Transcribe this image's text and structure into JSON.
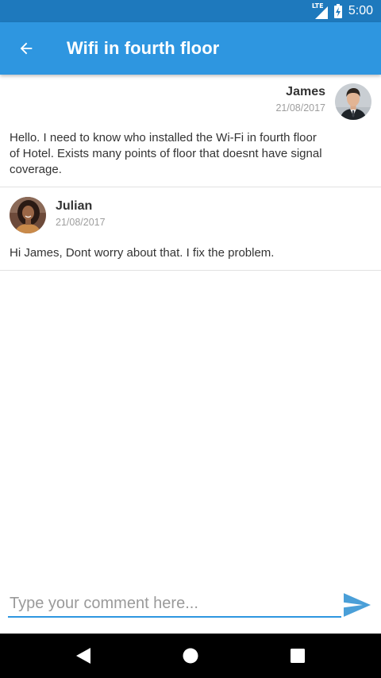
{
  "status_bar": {
    "network_label": "LTE",
    "time": "5:00"
  },
  "app_bar": {
    "title": "Wifi in fourth floor",
    "back_icon": "arrow-left-icon"
  },
  "messages": [
    {
      "sender": "James",
      "date": "21/08/2017",
      "text": "Hello. I need to know who installed the Wi-Fi in fourth floor of Hotel. Exists many points of floor that doesnt have signal coverage.",
      "alignment": "right"
    },
    {
      "sender": "Julian",
      "date": "21/08/2017",
      "text": "Hi James, Dont worry about that. I fix the problem.",
      "alignment": "left"
    }
  ],
  "comment": {
    "placeholder": "Type your comment here...",
    "value": "",
    "send_icon": "send-icon"
  },
  "nav_bar": {
    "back_icon": "nav-back-icon",
    "home_icon": "nav-home-icon",
    "recents_icon": "nav-recents-icon"
  },
  "colors": {
    "status_bar": "#1E79BD",
    "app_bar": "#2E96E0",
    "accent": "#2E96E0",
    "send_icon": "#4A9FD8"
  }
}
